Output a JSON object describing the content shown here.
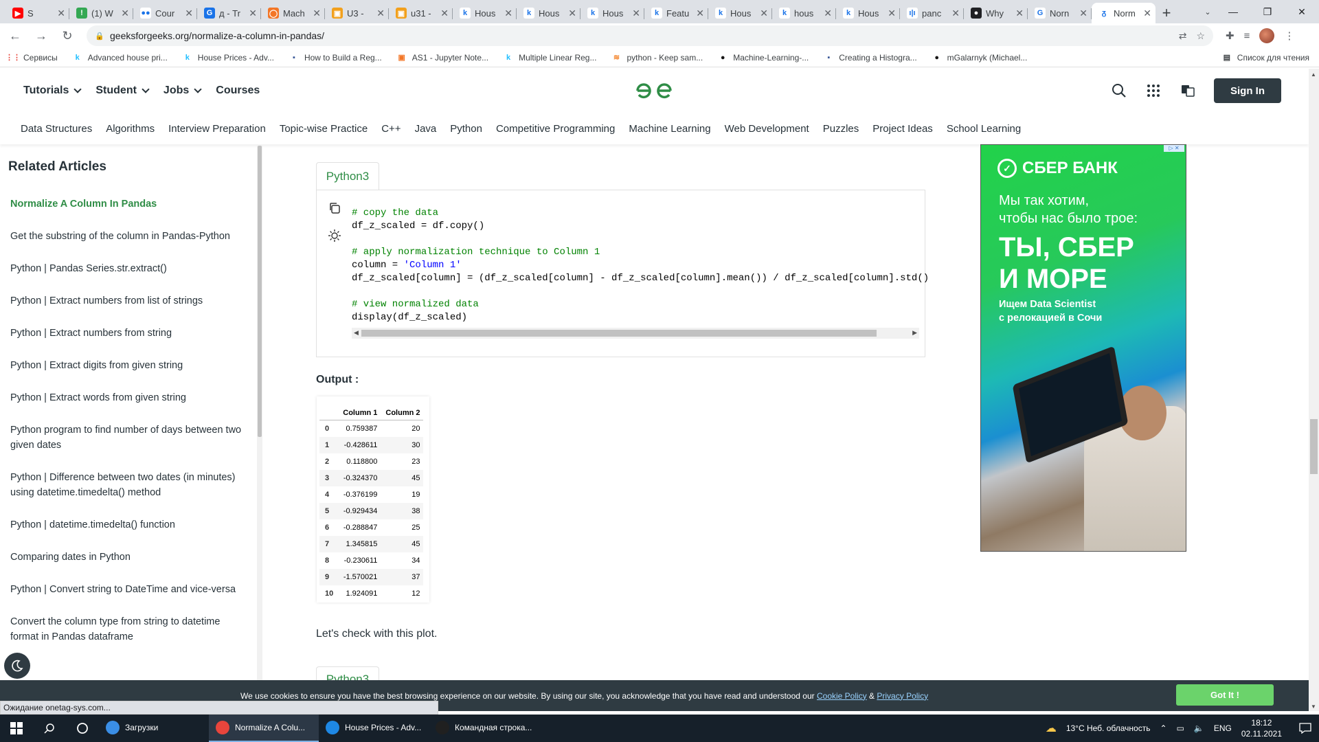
{
  "browser": {
    "tabs": [
      {
        "title": "S",
        "fav_bg": "#ff0000",
        "fav": "▶"
      },
      {
        "title": "(1) W",
        "fav_bg": "#34a853",
        "fav": "!"
      },
      {
        "title": "Cour",
        "fav_bg": "#ffffff",
        "fav": "●●"
      },
      {
        "title": "д - Tr",
        "fav_bg": "#1a73e8",
        "fav": "G"
      },
      {
        "title": "Mach",
        "fav_bg": "#f37626",
        "fav": "◯"
      },
      {
        "title": "U3 -",
        "fav_bg": "#f2a01c",
        "fav": "▣"
      },
      {
        "title": "u31 -",
        "fav_bg": "#f2a01c",
        "fav": "▣"
      },
      {
        "title": "Hous",
        "fav_bg": "#ffffff",
        "fav": "k"
      },
      {
        "title": "Hous",
        "fav_bg": "#ffffff",
        "fav": "k"
      },
      {
        "title": "Hous",
        "fav_bg": "#ffffff",
        "fav": "k"
      },
      {
        "title": "Featu",
        "fav_bg": "#ffffff",
        "fav": "k"
      },
      {
        "title": "Hous",
        "fav_bg": "#ffffff",
        "fav": "k"
      },
      {
        "title": "hous",
        "fav_bg": "#ffffff",
        "fav": "k"
      },
      {
        "title": "Hous",
        "fav_bg": "#ffffff",
        "fav": "k"
      },
      {
        "title": "panc",
        "fav_bg": "#ffffff",
        "fav": "ı|ı"
      },
      {
        "title": "Why",
        "fav_bg": "#202124",
        "fav": "●"
      },
      {
        "title": "Norn",
        "fav_bg": "#ffffff",
        "fav": "G"
      },
      {
        "title": "Norm",
        "fav_bg": "#ffffff",
        "fav": "ᵹ"
      }
    ],
    "active_tab_index": 17,
    "url": "geeksforgeeks.org/normalize-a-column-in-pandas/",
    "bookmarks": [
      {
        "label": "Сервисы",
        "icon": "apps-icon"
      },
      {
        "label": "Advanced house pri...",
        "icon": "kaggle-icon"
      },
      {
        "label": "House Prices - Adv...",
        "icon": "kaggle-icon"
      },
      {
        "label": "How to Build a Reg...",
        "icon": "site-icon"
      },
      {
        "label": "AS1 - Jupyter Note...",
        "icon": "jupyter-icon"
      },
      {
        "label": "Multiple Linear Reg...",
        "icon": "kaggle-icon"
      },
      {
        "label": "python - Keep sam...",
        "icon": "stackoverflow-icon"
      },
      {
        "label": "Machine-Learning-...",
        "icon": "github-icon"
      },
      {
        "label": "Creating a Histogra...",
        "icon": "site-icon"
      },
      {
        "label": "mGalarnyk (Michael...",
        "icon": "github-icon"
      }
    ],
    "reading_list": "Список для чтения",
    "status_text": "Ожидание onetag-sys.com..."
  },
  "header": {
    "menu": [
      "Tutorials",
      "Student",
      "Jobs",
      "Courses"
    ],
    "sign_in": "Sign In"
  },
  "subnav": [
    "Data Structures",
    "Algorithms",
    "Interview Preparation",
    "Topic-wise Practice",
    "C++",
    "Java",
    "Python",
    "Competitive Programming",
    "Machine Learning",
    "Web Development",
    "Puzzles",
    "Project Ideas",
    "School Learning"
  ],
  "sidebar": {
    "title": "Related Articles",
    "articles": [
      "Normalize A Column In Pandas",
      "Get the substring of the column in Pandas-Python",
      "Python | Pandas Series.str.extract()",
      "Python | Extract numbers from list of strings",
      "Python | Extract numbers from string",
      "Python | Extract digits from given string",
      "Python | Extract words from given string",
      "Python program to find number of days between two given dates",
      "Python | Difference between two dates (in minutes) using datetime.timedelta() method",
      "Python | datetime.timedelta() function",
      "Comparing dates in Python",
      "Python | Convert string to DateTime and vice-versa",
      "Convert the column type from string to datetime format in Pandas dataframe"
    ]
  },
  "main": {
    "code_tab": "Python3",
    "code_lines": [
      {
        "cls": "cm",
        "text": "# copy the data"
      },
      {
        "cls": "",
        "text": "df_z_scaled = df.copy()"
      },
      {
        "cls": "",
        "text": ""
      },
      {
        "cls": "cm",
        "text": "# apply normalization technique to Column 1"
      },
      {
        "cls": "mix",
        "pre": "column = ",
        "str": "'Column 1'",
        "post": ""
      },
      {
        "cls": "",
        "text": "df_z_scaled[column] = (df_z_scaled[column] - df_z_scaled[column].mean()) / df_z_scaled[column].std()"
      },
      {
        "cls": "",
        "text": ""
      },
      {
        "cls": "cm",
        "text": "# view normalized data"
      },
      {
        "cls": "",
        "text": "display(df_z_scaled)"
      }
    ],
    "output_label": "Output :",
    "table": {
      "columns": [
        "Column 1",
        "Column 2"
      ],
      "rows": [
        [
          "0",
          "0.759387",
          "20"
        ],
        [
          "1",
          "-0.428611",
          "30"
        ],
        [
          "2",
          "0.118800",
          "23"
        ],
        [
          "3",
          "-0.324370",
          "45"
        ],
        [
          "4",
          "-0.376199",
          "19"
        ],
        [
          "5",
          "-0.929434",
          "38"
        ],
        [
          "6",
          "-0.288847",
          "25"
        ],
        [
          "7",
          "1.345815",
          "45"
        ],
        [
          "8",
          "-0.230611",
          "34"
        ],
        [
          "9",
          "-1.570021",
          "37"
        ],
        [
          "10",
          "1.924091",
          "12"
        ]
      ]
    },
    "plot_text": "Let's check with this plot.",
    "code_tab_2": "Python3"
  },
  "ad": {
    "brand": "СБЕР БАНК",
    "line1": "Мы так хотим,",
    "line2": "чтобы нас было трое:",
    "big1": "ТЫ, СБЕР",
    "big2": "И МОРЕ",
    "small1": "Ищем Data Scientist",
    "small2": "с релокацией в Сочи"
  },
  "cookie": {
    "text": "We use cookies to ensure you have the best browsing experience on our website. By using our site, you acknowledge that you have read and understood our",
    "cookie_policy": "Cookie Policy",
    "amp": "&",
    "privacy_policy": "Privacy Policy",
    "button": "Got It !"
  },
  "taskbar": {
    "apps": [
      {
        "label": "Загрузки",
        "color": "#3a8ee6",
        "active": false
      },
      {
        "label": "Normalize A Colu...",
        "color": "#e8453c",
        "active": true
      },
      {
        "label": "House Prices - Adv...",
        "color": "#1e88e5",
        "active": false
      },
      {
        "label": "Командная строка...",
        "color": "#202020",
        "active": false
      }
    ],
    "weather": "13°C  Неб. облачность",
    "lang": "ENG",
    "time": "18:12",
    "date": "02.11.2021"
  }
}
